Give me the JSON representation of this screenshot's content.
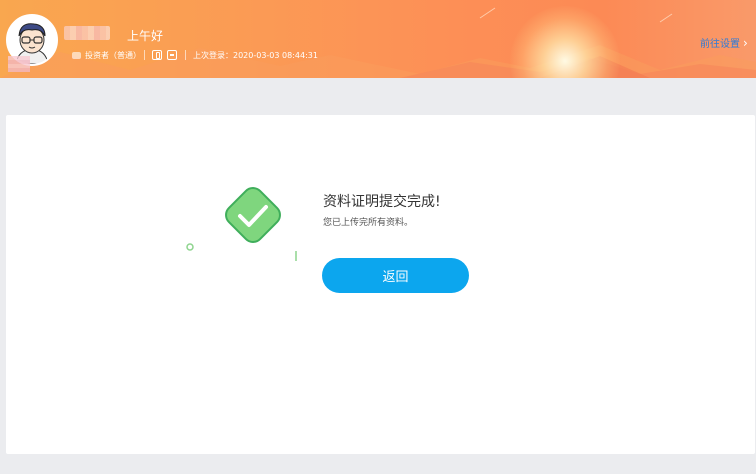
{
  "header": {
    "greeting": "上午好",
    "role": "投资者（普通）",
    "last_login": "上次登录：2020-03-03 08:44:31",
    "goto_settings": "前往设置",
    "icons": {
      "avatar": "avatar-cartoon-man",
      "phone": "phone-icon",
      "mail": "mail-icon",
      "role": "user-icon",
      "chevron": "chevron-right-icon"
    }
  },
  "main": {
    "title": "资料证明提交完成!",
    "subtitle": "您已上传完所有资料。",
    "return_button": "返回",
    "success_icon": "check-diamond-icon"
  },
  "colors": {
    "accent": "#0ca6ee",
    "success": "#57c46d",
    "header_orange": "#fc8f56",
    "link_blue": "#2f7bd8"
  }
}
